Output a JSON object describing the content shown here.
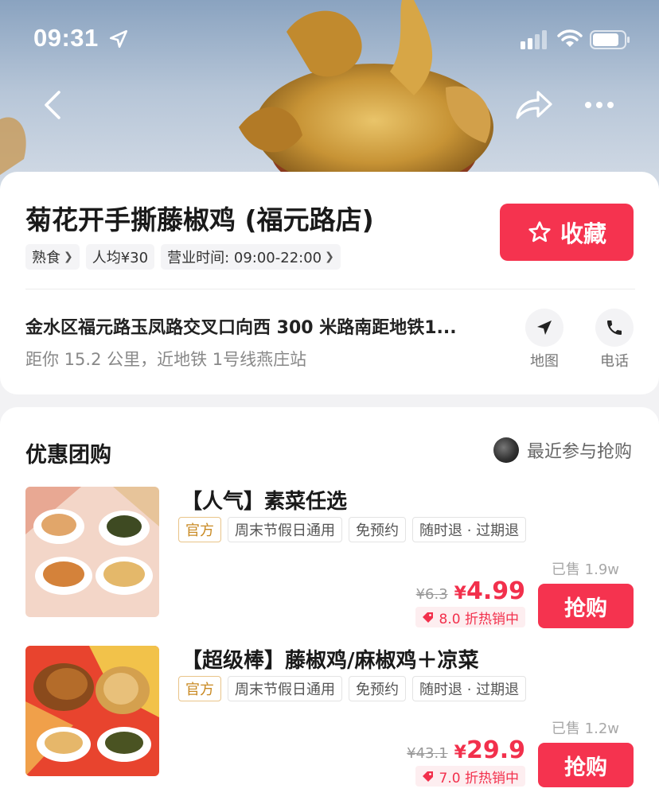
{
  "status_bar": {
    "time": "09:31"
  },
  "store": {
    "name": "菊花开手撕藤椒鸡 (福元路店)",
    "favorite_label": "收藏",
    "tags": [
      {
        "label": "熟食",
        "chevron": true
      },
      {
        "label": "人均¥30",
        "chevron": false
      },
      {
        "label": "营业时间: 09:00-22:00",
        "chevron": true
      }
    ],
    "address": "金水区福元路玉凤路交叉口向西 300 米路南距地铁1...",
    "distance": "距你 15.2 公里，近地铁 1号线燕庄站",
    "map_label": "地图",
    "phone_label": "电话"
  },
  "deals_section": {
    "title": "优惠团购",
    "recent_label": "最近参与抢购",
    "items": [
      {
        "title": "【人气】素菜任选",
        "tags": [
          "官方",
          "周末节假日通用",
          "免预约",
          "随时退 · 过期退"
        ],
        "sold": "已售 1.9w",
        "original_price": "¥6.3",
        "currency": "¥",
        "price": "4.99",
        "discount": "8.0 折热销中",
        "buy_label": "抢购"
      },
      {
        "title": "【超级棒】藤椒鸡/麻椒鸡＋凉菜",
        "tags": [
          "官方",
          "周末节假日通用",
          "免预约",
          "随时退 · 过期退"
        ],
        "sold": "已售 1.2w",
        "original_price": "¥43.1",
        "currency": "¥",
        "price": "29.9",
        "discount": "7.0 折热销中",
        "buy_label": "抢购"
      }
    ]
  },
  "icons": {
    "back": "back-arrow-icon",
    "share": "share-icon",
    "more": "more-icon",
    "favorite": "star-icon",
    "map": "navigation-arrow-icon",
    "phone": "phone-icon",
    "discount": "price-tag-icon"
  },
  "colors": {
    "accent": "#f5334f",
    "price": "#f2304c",
    "official_tag": "#c98a23"
  }
}
